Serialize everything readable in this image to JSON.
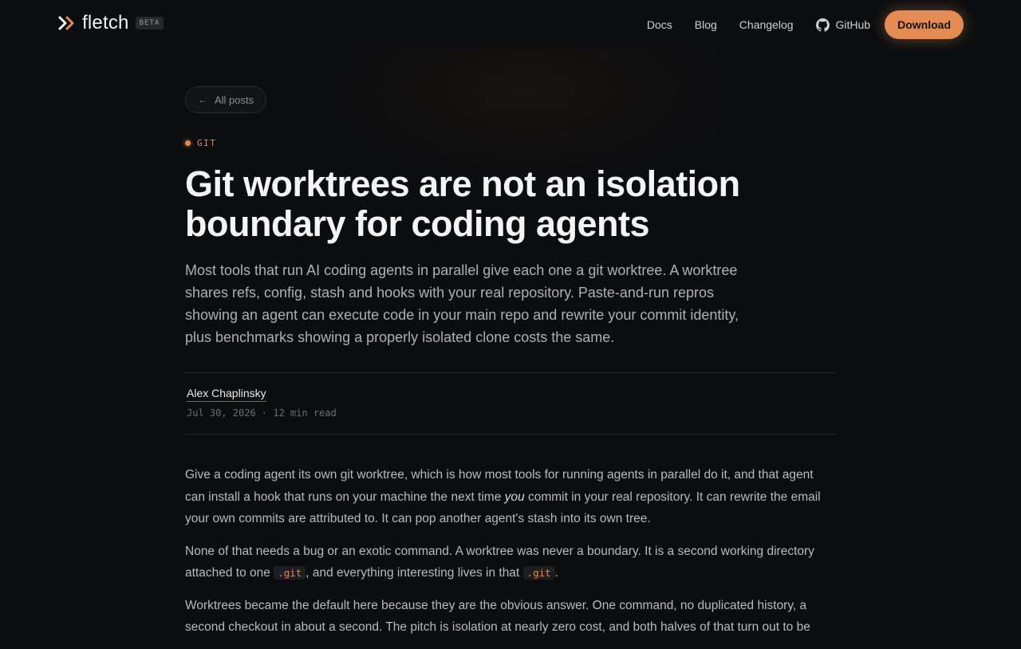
{
  "nav": {
    "brand": "fletch",
    "badge": "BETA",
    "links": [
      "Docs",
      "Blog",
      "Changelog"
    ],
    "github_label": "GitHub",
    "download_label": "Download"
  },
  "article": {
    "back_label": "All posts",
    "back_arrow": "←",
    "tag": "GIT",
    "title": "Git worktrees are not an isolation boundary for coding agents",
    "lede": "Most tools that run AI coding agents in parallel give each one a git worktree. A worktree shares refs, config, stash and hooks with your real repository. Paste-and-run repros showing an agent can execute code in your main repo and rewrite your commit identity, plus benchmarks showing a properly isolated clone costs the same.",
    "author": "Alex Chaplinsky",
    "meta": "Jul 30, 2026 · 12 min read",
    "paragraphs": {
      "p1_before": "Give a coding agent its own git worktree, which is how most tools for running agents in parallel do it, and that agent can install a hook that runs on your machine the next time ",
      "p1_em": "you",
      "p1_after": " commit in your real repository. It can rewrite the email your own commits are attributed to. It can pop another agent's stash into its own tree.",
      "p2_before": "None of that needs a bug or an exotic command. A worktree was never a boundary. It is a second working directory attached to one ",
      "p2_code1": ".git",
      "p2_mid": ", and everything interesting lives in that ",
      "p2_code2": ".git",
      "p2_after": ".",
      "p3": "Worktrees became the default here because they are the obvious answer. One command, no duplicated history, a second checkout in about a second. The pitch is isolation at nearly zero cost, and both halves of that turn out to be"
    }
  },
  "colors": {
    "accent": "#e38a55",
    "background": "#0c0d0f"
  }
}
